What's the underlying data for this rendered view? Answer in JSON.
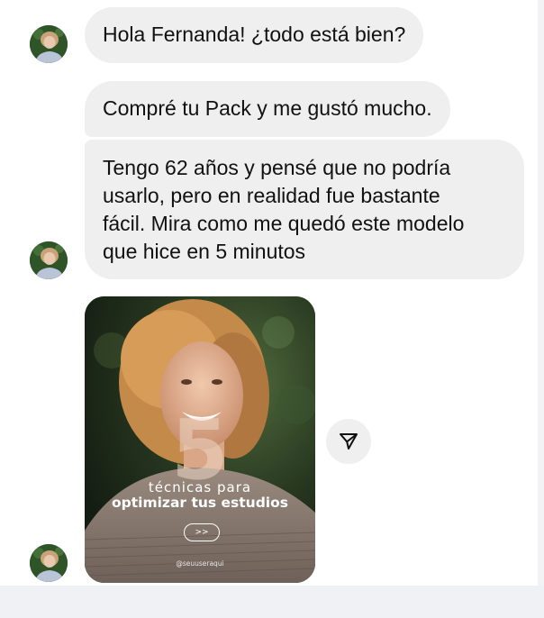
{
  "messages": [
    {
      "text": "Hola Fernanda! ¿todo está bien?"
    },
    {
      "text": "Compré tu Pack y me gustó mucho."
    },
    {
      "text": "Tengo 62 años y pensé que no podría\nusarlo, pero en realidad fue bastante\nfácil. Mira como me quedó este modelo\nque hice en 5 minutos"
    }
  ],
  "media_post": {
    "number": "5",
    "line1": "técnicas para",
    "line2": "optimizar tus estudios",
    "button": ">>",
    "handle": "@seuuseraqui"
  },
  "icons": {
    "avatar": "avatar-icon",
    "share": "send-icon"
  },
  "colors": {
    "bubble_bg": "#efefef",
    "text": "#111111",
    "footer_bg": "#f0f1f5"
  }
}
